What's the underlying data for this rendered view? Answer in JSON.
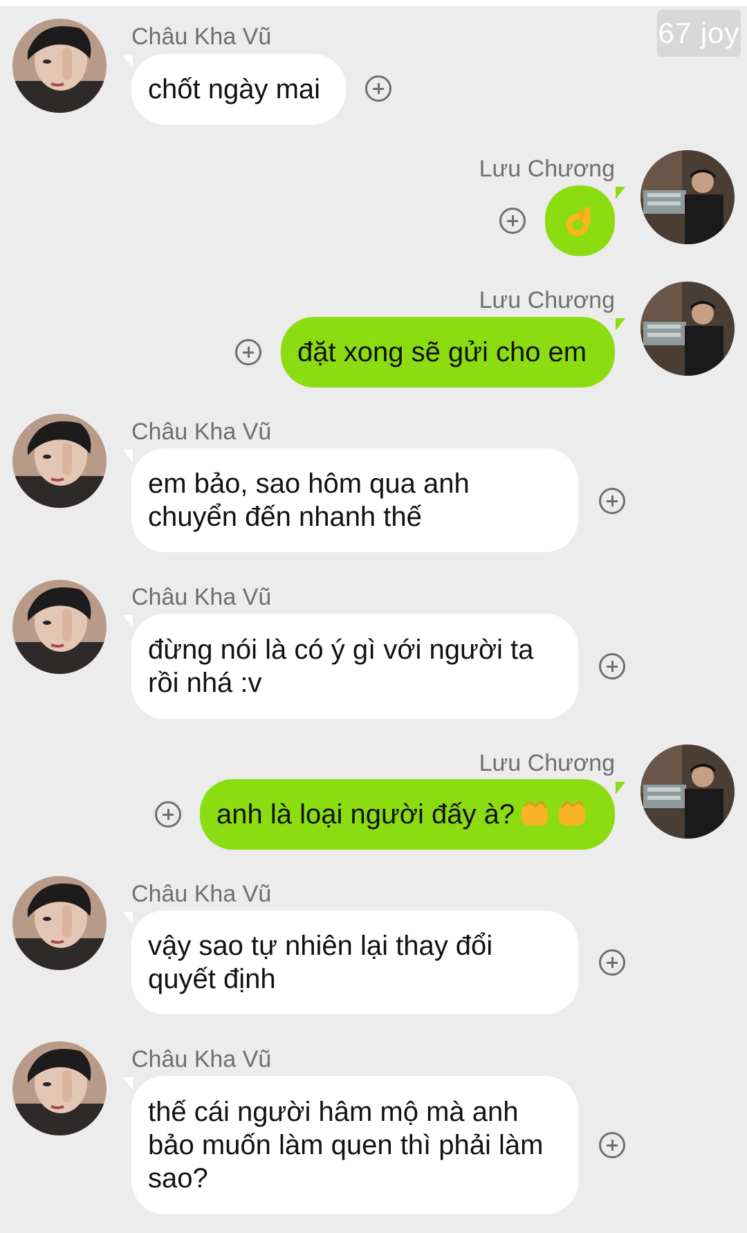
{
  "watermark": "67 joy",
  "colors": {
    "background": "#ececec",
    "incoming_bubble": "#ffffff",
    "outgoing_bubble": "#8bdc10",
    "sender_name": "#6f6f6f",
    "react_icon": "#6e6e6e"
  },
  "messages": [
    {
      "sender": "Châu Kha Vũ",
      "direction": "incoming",
      "text": "chốt ngày mai"
    },
    {
      "sender": "Lưu Chương",
      "direction": "outgoing",
      "text": "",
      "emoji": "ok-hand-emoji"
    },
    {
      "sender": "Lưu Chương",
      "direction": "outgoing",
      "text": "đặt xong sẽ gửi cho em"
    },
    {
      "sender": "Châu Kha Vũ",
      "direction": "incoming",
      "text": "em bảo, sao hôm qua anh\nchuyển đến nhanh thế"
    },
    {
      "sender": "Châu Kha Vũ",
      "direction": "incoming",
      "text": "đừng nói là có ý gì với người ta\nrồi nhá :v"
    },
    {
      "sender": "Lưu Chương",
      "direction": "outgoing",
      "text": "anh là loại người đấy à?",
      "emoji": "fist-bump-emoji"
    },
    {
      "sender": "Châu Kha Vũ",
      "direction": "incoming",
      "text": "vậy sao tự nhiên lại thay đổi\nquyết định"
    },
    {
      "sender": "Châu Kha Vũ",
      "direction": "incoming",
      "text": "thế cái người hâm mộ mà anh\nbảo muốn làm quen thì phải làm\nsao?"
    }
  ]
}
